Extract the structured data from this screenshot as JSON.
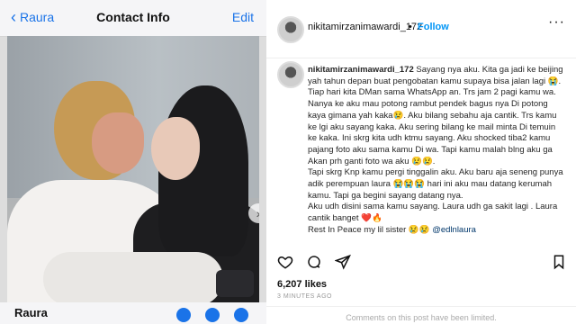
{
  "phone": {
    "back_label": "Raura",
    "title": "Contact Info",
    "edit_label": "Edit",
    "contact_name": "Raura"
  },
  "post": {
    "username": "nikitamirzanimawardi_172",
    "follow_label": "Follow",
    "caption_lines": [
      "Sayang nya aku. Kita ga jadi ke beijing",
      "yah tahun depan buat pengobatan kamu supaya bisa jalan lagi 😭.",
      "Tiap hari kita DMan sama WhatsApp an. Trs jam 2 pagi kamu wa.",
      "Nanya ke aku mau potong rambut pendek bagus nya Di potong",
      "kaya gimana yah kaka😢. Aku bilang sebahu aja cantik. Trs kamu",
      "ke lgi aku sayang kaka. Aku sering bilang ke mail minta Di temuin",
      "ke kaka. Ini skrg kita udh ktmu sayang. Aku shocked tiba2 kamu",
      "pajang foto aku sama kamu Di wa. Tapi kamu malah blng aku ga",
      "Akan prh ganti foto wa aku 😢😢.",
      "Tapi skrg Knp kamu pergi tinggalin aku. Aku baru aja seneng punya",
      "adik perempuan laura 😭😭😭 hari ini aku mau datang kerumah",
      "kamu. Tapi ga begini sayang datang nya.",
      "Aku udh disini sama kamu sayang. Laura udh ga sakit lagi . Laura",
      "cantik banget ❤️🔥",
      "Rest In Peace my lil sister 😢😢 "
    ],
    "mention": "@edlnlaura",
    "likes": "6,207 likes",
    "time": "3 MINUTES AGO",
    "comments_notice": "Comments on this post have been limited."
  },
  "icons": {
    "heart": "heart-icon",
    "comment": "comment-icon",
    "share": "share-icon",
    "save": "bookmark-icon",
    "more": "more-options-icon"
  },
  "colors": {
    "ios_blue": "#1a73e8",
    "follow_blue": "#0095f6"
  }
}
